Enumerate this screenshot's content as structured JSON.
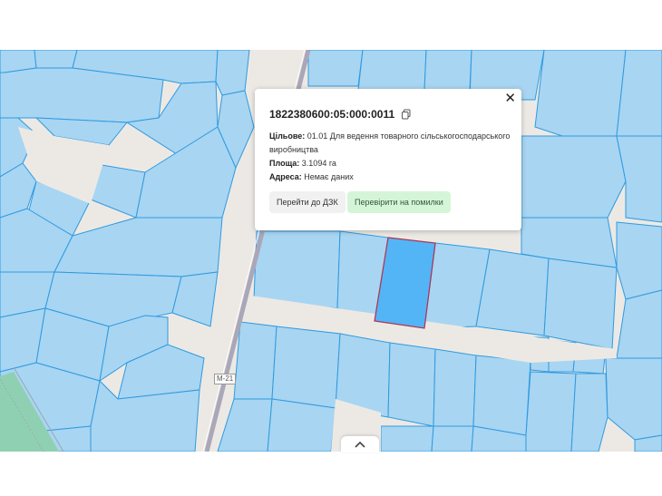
{
  "parcel": {
    "cadastral_number": "1822380600:05:000:0011",
    "purpose_label": "Цільове:",
    "purpose_value": "01.01 Для ведення товарного сільськогосподарського виробництва",
    "area_label": "Площа:",
    "area_value": "3.1094 га",
    "address_label": "Адреса:",
    "address_value": "Немає даних"
  },
  "buttons": {
    "go_to_dzk": "Перейти до ДЗК",
    "check_errors": "Перевірити на помилки"
  },
  "map": {
    "road_label": "M-21"
  },
  "icons": {
    "close": "close-icon",
    "copy": "copy-icon",
    "collapse": "chevron-up-icon"
  },
  "colors": {
    "parcel_fill": "#a8d5f2",
    "parcel_stroke": "#2f9ae0",
    "selected_fill": "#53b4f6",
    "selected_stroke": "#b2304f",
    "forest": "#8fd0b2",
    "check_button_bg": "#d6f5d8"
  }
}
